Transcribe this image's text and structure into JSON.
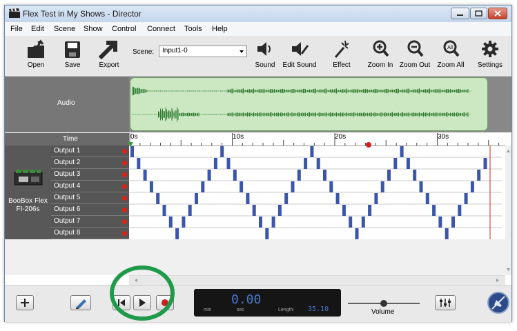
{
  "window": {
    "title": "Flex Test in My Shows - Director"
  },
  "menu": [
    "File",
    "Edit",
    "Scene",
    "Show",
    "Control",
    "Connect",
    "Tools",
    "Help"
  ],
  "toolbar": {
    "open": "Open",
    "save": "Save",
    "export": "Export",
    "scene_label": "Scene:",
    "scene_value": "Input1-0",
    "sound": "Sound",
    "edit_sound": "Edit Sound",
    "effect": "Effect",
    "zoom_in": "Zoom In",
    "zoom_out": "Zoom Out",
    "zoom_all": "Zoom All",
    "zoom_all_badge": "All",
    "settings": "Settings"
  },
  "tracks": {
    "audio_label": "Audio",
    "time_label": "Time",
    "ruler_ticks": [
      "0s",
      "10s",
      "20s",
      "30s"
    ],
    "device_name": "BooBox Flex FI-206s",
    "outputs": [
      "Output 1",
      "Output 2",
      "Output 3",
      "Output 4",
      "Output 5",
      "Output 6",
      "Output 7",
      "Output 8"
    ]
  },
  "transport": {
    "time_display": "0.00",
    "min_label": "min",
    "sec_label": "sec",
    "length_label": "Length:",
    "length_value": "35.10",
    "volume_label": "Volume",
    "volume_level": 0.5
  },
  "colors": {
    "wave": "#2f7a2f",
    "wave_bg": "#cbe8c3",
    "event_blue": "#3b55a8",
    "playhead_red": "#cc2222",
    "lcd_text": "#4a79d0"
  }
}
